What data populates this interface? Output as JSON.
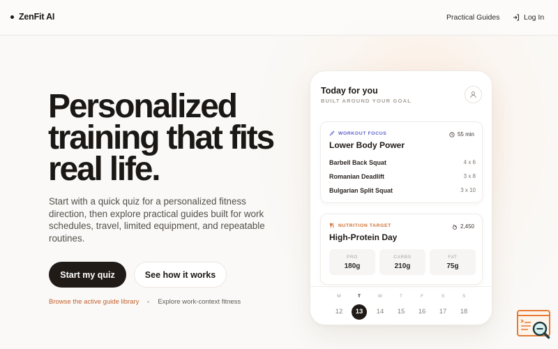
{
  "brand": {
    "name": "ZenFit AI"
  },
  "nav": {
    "guides": "Practical Guides",
    "login": "Log In"
  },
  "hero": {
    "title": "Personalized training that fits real life.",
    "subtitle": "Start with a quick quiz for a personalized fitness direction, then explore practical guides built for work schedules, travel, limited equipment, and repeatable routines.",
    "primary_button": "Start my quiz",
    "secondary_button": "See how it works",
    "link_library": "Browse the active guide library",
    "link_work": "Explore work-context fitness"
  },
  "phone": {
    "title": "Today for you",
    "subtitle": "BUILT AROUND YOUR GOAL",
    "workout": {
      "tag": "WORKOUT FOCUS",
      "duration": "55 min",
      "title": "Lower Body Power",
      "exercises": [
        {
          "name": "Barbell Back Squat",
          "sets": "4 x 6"
        },
        {
          "name": "Romanian Deadlift",
          "sets": "3 x 8"
        },
        {
          "name": "Bulgarian Split Squat",
          "sets": "3 x 10"
        }
      ]
    },
    "nutrition": {
      "tag": "NUTRITION TARGET",
      "calories": "2,450",
      "title": "High-Protein Day",
      "macros": [
        {
          "label": "PRO",
          "value": "180g"
        },
        {
          "label": "CARBS",
          "value": "210g"
        },
        {
          "label": "FAT",
          "value": "75g"
        }
      ]
    },
    "calendar": [
      {
        "day": "M",
        "date": "12"
      },
      {
        "day": "T",
        "date": "13"
      },
      {
        "day": "W",
        "date": "14"
      },
      {
        "day": "T",
        "date": "15"
      },
      {
        "day": "F",
        "date": "16"
      },
      {
        "day": "S",
        "date": "17"
      },
      {
        "day": "S",
        "date": "18"
      }
    ],
    "calendar_active_date": "13"
  },
  "colors": {
    "accent": "#c4602b",
    "dark": "#211b17",
    "workout_tag": "#5a5fc6",
    "nutrition_tag": "#cf6d30"
  }
}
